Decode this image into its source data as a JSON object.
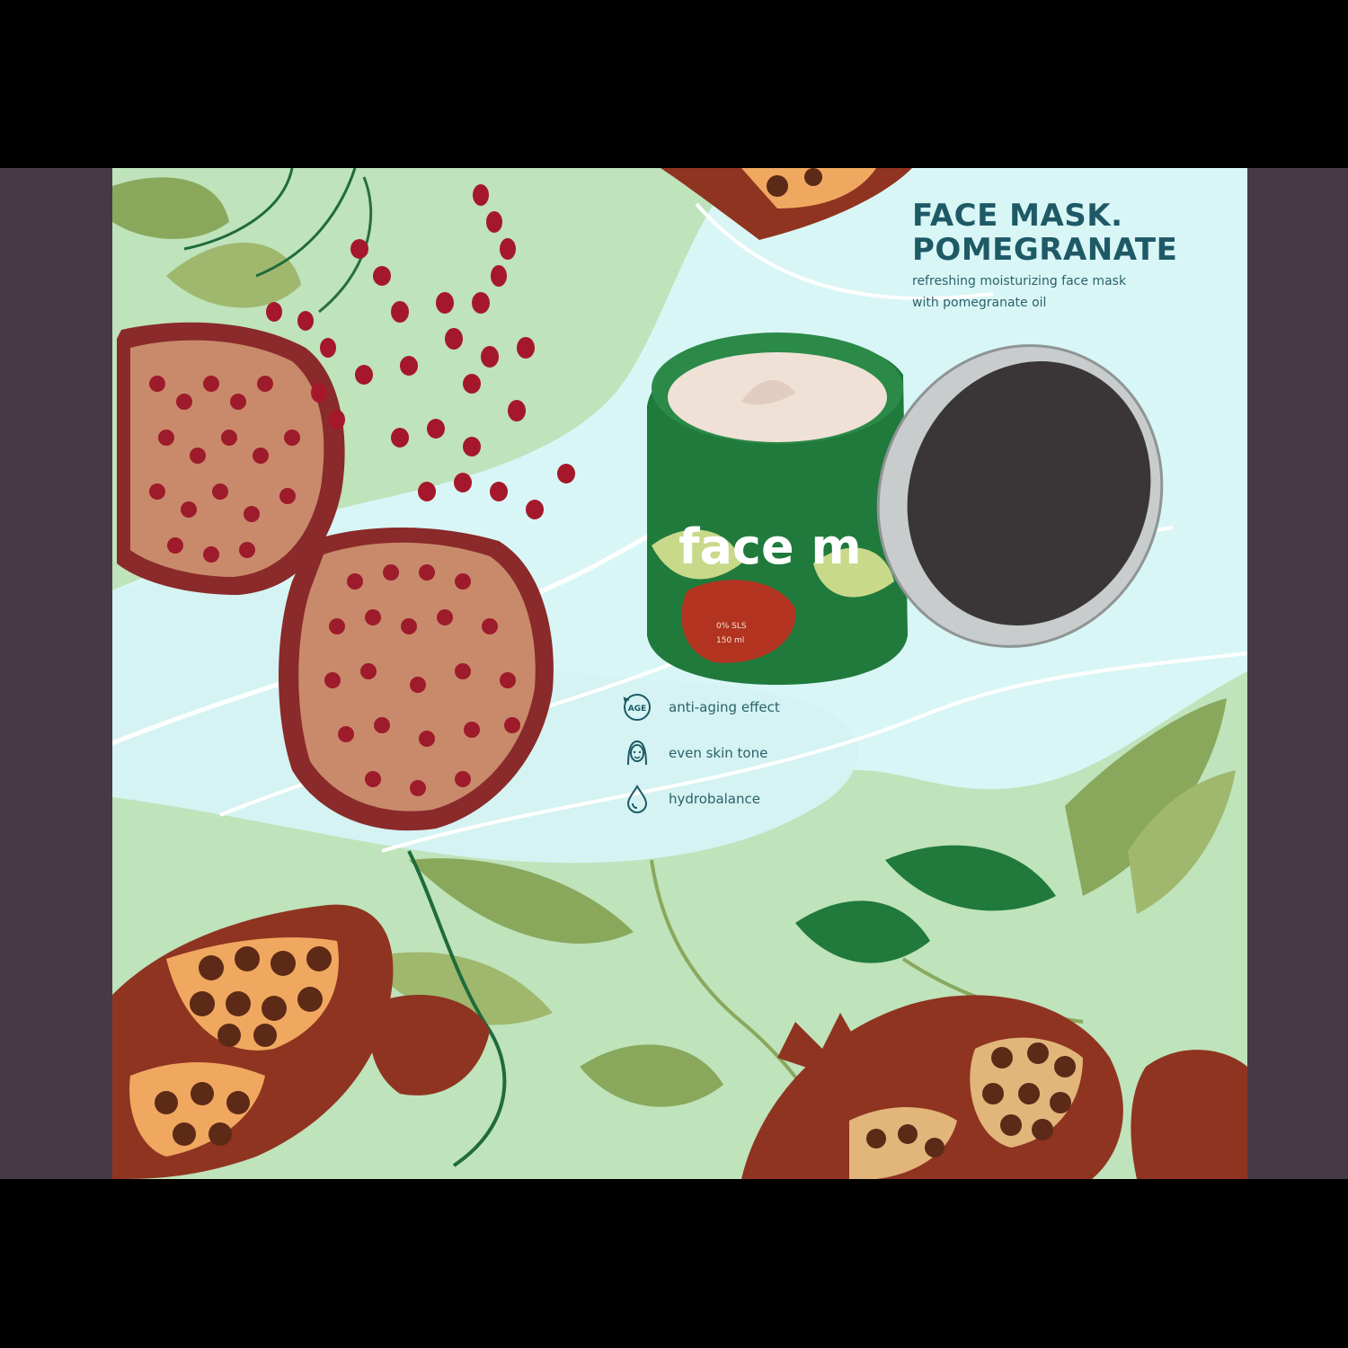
{
  "product": {
    "title_line1": "FACE MASK.",
    "title_line2": "POMEGRANATE",
    "subtitle_line1": "refreshing moisturizing face mask",
    "subtitle_line2": "with pomegranate oil",
    "jar_label": "face m",
    "jar_small_text_1": "0% SLS",
    "jar_small_text_2": "150 ml"
  },
  "benefits": [
    {
      "icon": "age-icon",
      "icon_text": "AGE",
      "label": "anti-aging effect"
    },
    {
      "icon": "face-icon",
      "label": "even skin tone"
    },
    {
      "icon": "water-drop-icon",
      "label": "hydrobalance"
    }
  ],
  "colors": {
    "accent_teal": "#1e5a66",
    "side_panel": "#463a47",
    "mint_background": "#bfe3bb",
    "light_cyan": "#d9f6f6",
    "terracotta": "#8f3420",
    "olive": "#8aa85c",
    "jar_green": "#1f7a3c"
  }
}
